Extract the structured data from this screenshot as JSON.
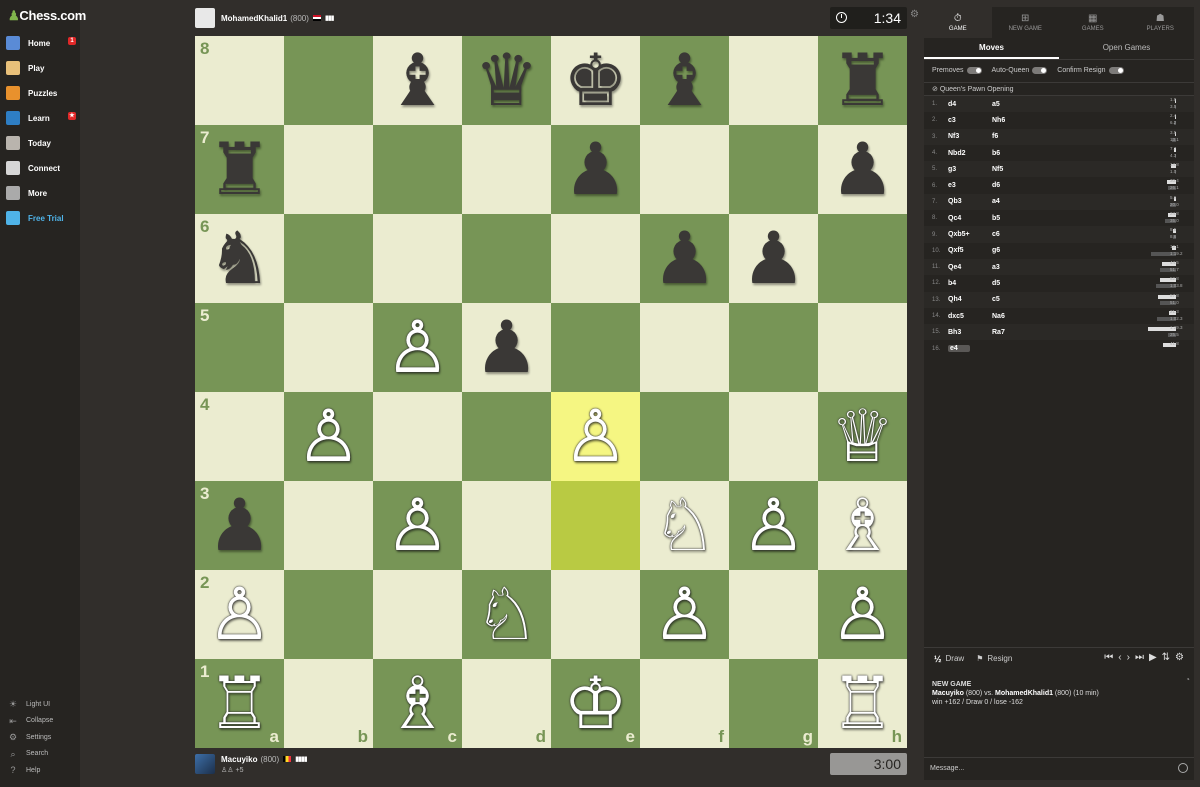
{
  "app": {
    "logo": "Chess.com"
  },
  "nav": {
    "items": [
      {
        "label": "Home",
        "icon": "home-icon",
        "color": "#5a8bd6",
        "badge": "1"
      },
      {
        "label": "Play",
        "icon": "play-icon",
        "color": "#e8c07a"
      },
      {
        "label": "Puzzles",
        "icon": "puzzle-icon",
        "color": "#e8912d"
      },
      {
        "label": "Learn",
        "icon": "learn-icon",
        "color": "#2e7ec4",
        "badge": "★"
      },
      {
        "label": "Today",
        "icon": "today-icon",
        "color": "#b9b4ad"
      },
      {
        "label": "Connect",
        "icon": "connect-icon",
        "color": "#d6d6d6"
      },
      {
        "label": "More",
        "icon": "more-icon",
        "color": "#aaaaaa"
      },
      {
        "label": "Free Trial",
        "icon": "diamond-icon",
        "color": "#4fb3e8"
      }
    ],
    "bottom": [
      {
        "label": "Light UI",
        "icon": "sun-icon",
        "glyph": "☀"
      },
      {
        "label": "Collapse",
        "icon": "collapse-icon",
        "glyph": "⇤"
      },
      {
        "label": "Settings",
        "icon": "settings-icon",
        "glyph": "⚙"
      },
      {
        "label": "Search",
        "icon": "search-icon",
        "glyph": "⌕"
      },
      {
        "label": "Help",
        "icon": "help-icon",
        "glyph": "?"
      }
    ]
  },
  "top_player": {
    "name": "MohamedKhalid1",
    "rating": "(800)",
    "clock": "1:34",
    "bars": "▮▮▮"
  },
  "bottom_player": {
    "name": "Macuyiko",
    "rating": "(800)",
    "clock": "3:00",
    "bars": "▮▮▮▮",
    "captured": "♙♙ +5"
  },
  "board": {
    "ranks": [
      "8",
      "7",
      "6",
      "5",
      "4",
      "3",
      "2",
      "1"
    ],
    "files": [
      "a",
      "b",
      "c",
      "d",
      "e",
      "f",
      "g",
      "h"
    ],
    "highlight": [
      "e4",
      "e3"
    ],
    "pieces": [
      {
        "sq": "c8",
        "p": "♝",
        "c": "b"
      },
      {
        "sq": "d8",
        "p": "♛",
        "c": "b"
      },
      {
        "sq": "e8",
        "p": "♚",
        "c": "b"
      },
      {
        "sq": "f8",
        "p": "♝",
        "c": "b"
      },
      {
        "sq": "h8",
        "p": "♜",
        "c": "b"
      },
      {
        "sq": "a7",
        "p": "♜",
        "c": "b"
      },
      {
        "sq": "e7",
        "p": "♟",
        "c": "b"
      },
      {
        "sq": "h7",
        "p": "♟",
        "c": "b"
      },
      {
        "sq": "a6",
        "p": "♞",
        "c": "b"
      },
      {
        "sq": "f6",
        "p": "♟",
        "c": "b"
      },
      {
        "sq": "g6",
        "p": "♟",
        "c": "b"
      },
      {
        "sq": "c5",
        "p": "♙",
        "c": "w"
      },
      {
        "sq": "d5",
        "p": "♟",
        "c": "b"
      },
      {
        "sq": "b4",
        "p": "♙",
        "c": "w"
      },
      {
        "sq": "e4",
        "p": "♙",
        "c": "w"
      },
      {
        "sq": "h4",
        "p": "♕",
        "c": "w"
      },
      {
        "sq": "a3",
        "p": "♟",
        "c": "b"
      },
      {
        "sq": "c3",
        "p": "♙",
        "c": "w"
      },
      {
        "sq": "f3",
        "p": "♘",
        "c": "w"
      },
      {
        "sq": "g3",
        "p": "♙",
        "c": "w"
      },
      {
        "sq": "h3",
        "p": "♗",
        "c": "w"
      },
      {
        "sq": "a2",
        "p": "♙",
        "c": "w"
      },
      {
        "sq": "d2",
        "p": "♘",
        "c": "w"
      },
      {
        "sq": "f2",
        "p": "♙",
        "c": "w"
      },
      {
        "sq": "h2",
        "p": "♙",
        "c": "w"
      },
      {
        "sq": "a1",
        "p": "♖",
        "c": "w"
      },
      {
        "sq": "c1",
        "p": "♗",
        "c": "w"
      },
      {
        "sq": "e1",
        "p": "♔",
        "c": "w"
      },
      {
        "sq": "h1",
        "p": "♖",
        "c": "w"
      }
    ]
  },
  "panel": {
    "tabs": [
      {
        "label": "GAME",
        "icon": "game-icon",
        "glyph": "⏱"
      },
      {
        "label": "NEW GAME",
        "icon": "plus-icon",
        "glyph": "⊞"
      },
      {
        "label": "GAMES",
        "icon": "games-icon",
        "glyph": "▦"
      },
      {
        "label": "PLAYERS",
        "icon": "players-icon",
        "glyph": "☗"
      }
    ],
    "subtabs": [
      "Moves",
      "Open Games"
    ],
    "toggles": [
      "Premoves",
      "Auto-Queen",
      "Confirm Resign"
    ],
    "opening": "Queen's Pawn Opening",
    "moves": [
      {
        "n": "1.",
        "w": "d4",
        "b": "a5",
        "t1": "1.9",
        "t2": "3.5"
      },
      {
        "n": "2.",
        "w": "c3",
        "b": "Nh6",
        "t1": "2.4",
        "t2": "6.2"
      },
      {
        "n": "3.",
        "w": "Nf3",
        "b": "f6",
        "t1": "3.5",
        "t2": "13.1"
      },
      {
        "n": "4.",
        "w": "Nbd2",
        "b": "b6",
        "t1": "7.7",
        "t2": "4.3"
      },
      {
        "n": "5.",
        "w": "g3",
        "b": "Nf5",
        "t1": "14.8",
        "t2": "1.0"
      },
      {
        "n": "6.",
        "w": "e3",
        "b": "d6",
        "t1": "30.4",
        "t2": "26.1"
      },
      {
        "n": "7.",
        "w": "Qb3",
        "b": "a4",
        "t1": "5.9",
        "t2": "20.0"
      },
      {
        "n": "8.",
        "w": "Qc4",
        "b": "b5",
        "t1": "24.8",
        "t2": "35.0"
      },
      {
        "n": "9.",
        "w": "Qxb5+",
        "b": "c6",
        "t1": "8.5",
        "t2": "8.6"
      },
      {
        "n": "10.",
        "w": "Qxf5",
        "b": "g6",
        "t1": "12.1",
        "t2": "1:19.2"
      },
      {
        "n": "11.",
        "w": "Qe4",
        "b": "a3",
        "t1": "44.5",
        "t2": "51.7"
      },
      {
        "n": "12.",
        "w": "b4",
        "b": "d5",
        "t1": "52.8",
        "t2": "1:03.8"
      },
      {
        "n": "13.",
        "w": "Qh4",
        "b": "c5",
        "t1": "57.8",
        "t2": "51.0"
      },
      {
        "n": "14.",
        "w": "dxc5",
        "b": "Na6",
        "t1": "21.3",
        "t2": "1:02.3"
      },
      {
        "n": "15.",
        "w": "Bh3",
        "b": "Ra7",
        "t1": "1:29.3",
        "t2": "25.5"
      },
      {
        "n": "16.",
        "w": "e4",
        "b": "",
        "t1": "41.8",
        "t2": ""
      }
    ],
    "controls": {
      "draw": "Draw",
      "draw_glyph": "½",
      "resign": "Resign"
    },
    "chat": {
      "heading": "NEW GAME",
      "white": "Macuyiko",
      "white_rating": " (800) vs. ",
      "black": "MohamedKhalid1",
      "black_rating": " (800) (10 min)",
      "stats": "win +162 / Draw 0 / lose -162"
    },
    "message_placeholder": "Message..."
  }
}
